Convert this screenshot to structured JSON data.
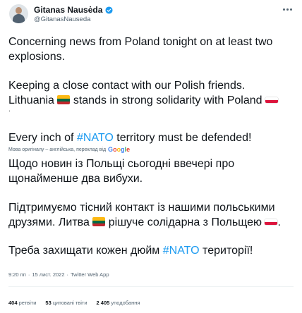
{
  "author": {
    "name": "Gitanas Nausėda",
    "handle": "@GitanasNauseda",
    "verified_icon": "verified-badge-icon",
    "more_icon": "more-dots-icon"
  },
  "tweet": {
    "p1_line1": "Concerning news from Poland tonight on at least two",
    "p1_line2": "explosions.",
    "p2_line1": "Keeping a close contact with our Polish friends.",
    "p2_line2_a": "Lithuania ",
    "p2_line2_b": " stands in strong solidarity with Poland ",
    "p2_line3": ".",
    "p3_a": "Every inch of ",
    "p3_hashtag": "#NATO",
    "p3_b": " territory must be defended!"
  },
  "translation": {
    "label": "Мова оригіналу – англійська, переклад від",
    "brand": "Google",
    "p1_line1": "Щодо новин із Польщі сьогодні ввечері про",
    "p1_line2": "щонайменше два вибухи.",
    "p2_line1": "Підтримуємо тісний контакт із нашими польськими",
    "p2_line2_a": "друзями. Литва ",
    "p2_line2_b": " рішуче солідарна з Польщею ",
    "p2_line2_c": ".",
    "p3_a": "Треба захищати кожен дюйм ",
    "p3_hashtag": "#NATO",
    "p3_b": " території!"
  },
  "meta": {
    "time": "9:20 пп",
    "sep1": "·",
    "date": "15 лист. 2022",
    "sep2": "·",
    "source": "Twitter Web App"
  },
  "stats": {
    "retweets_count": "404",
    "retweets_label": "ретвіти",
    "quotes_count": "53",
    "quotes_label": "цитовані твіти",
    "likes_count": "2 405",
    "likes_label": "уподобання"
  },
  "colors": {
    "accent": "#1d9bf0",
    "text": "#0f1419",
    "muted": "#536471",
    "lt_flag": [
      "#fdb913",
      "#006a44",
      "#c1272d"
    ],
    "pl_flag": [
      "#ffffff",
      "#dc143c"
    ]
  }
}
